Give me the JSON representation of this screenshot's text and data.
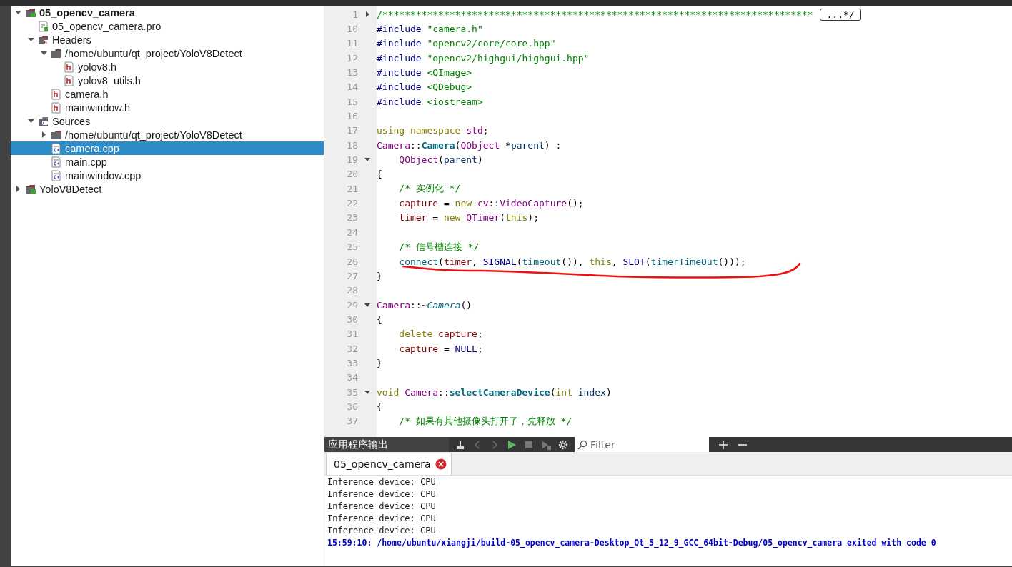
{
  "project_tree": {
    "items": [
      {
        "label": "05_opencv_camera",
        "kind": "project",
        "active": true,
        "expanded": true,
        "selected": false,
        "children": [
          {
            "label": "05_opencv_camera.pro",
            "kind": "pro-file",
            "selected": false
          },
          {
            "label": "Headers",
            "kind": "header-folder",
            "expanded": true,
            "selected": false,
            "children": [
              {
                "label": "/home/ubuntu/qt_project/YoloV8Detect",
                "kind": "folder",
                "expanded": true,
                "selected": false,
                "children": [
                  {
                    "label": "yolov8.h",
                    "kind": "header-file",
                    "selected": false
                  },
                  {
                    "label": "yolov8_utils.h",
                    "kind": "header-file",
                    "selected": false
                  }
                ]
              },
              {
                "label": "camera.h",
                "kind": "header-file",
                "selected": false
              },
              {
                "label": "mainwindow.h",
                "kind": "header-file",
                "selected": false
              }
            ]
          },
          {
            "label": "Sources",
            "kind": "source-folder",
            "expanded": true,
            "selected": false,
            "children": [
              {
                "label": "/home/ubuntu/qt_project/YoloV8Detect",
                "kind": "folder",
                "expanded": false,
                "selected": false
              },
              {
                "label": "camera.cpp",
                "kind": "source-file",
                "selected": true
              },
              {
                "label": "main.cpp",
                "kind": "source-file",
                "selected": false
              },
              {
                "label": "mainwindow.cpp",
                "kind": "source-file",
                "selected": false
              }
            ]
          }
        ]
      },
      {
        "label": "YoloV8Detect",
        "kind": "project",
        "active": false,
        "expanded": false,
        "selected": false
      }
    ]
  },
  "editor": {
    "lines": [
      {
        "number": "1",
        "expanded": false,
        "folded_text": "...*/",
        "tokens": [
          {
            "kind": "comment",
            "text": "/*****************************************************************************"
          }
        ]
      },
      {
        "number": "10",
        "tokens": [
          {
            "kind": "preproc",
            "text": "#include "
          },
          {
            "kind": "string",
            "text": "\"camera.h\""
          }
        ]
      },
      {
        "number": "11",
        "tokens": [
          {
            "kind": "preproc",
            "text": "#include "
          },
          {
            "kind": "string",
            "text": "\"opencv2/core/core.hpp\""
          }
        ]
      },
      {
        "number": "12",
        "tokens": [
          {
            "kind": "preproc",
            "text": "#include "
          },
          {
            "kind": "string",
            "text": "\"opencv2/highgui/highgui.hpp\""
          }
        ]
      },
      {
        "number": "13",
        "tokens": [
          {
            "kind": "preproc",
            "text": "#include "
          },
          {
            "kind": "string",
            "text": "<QImage>"
          }
        ]
      },
      {
        "number": "14",
        "tokens": [
          {
            "kind": "preproc",
            "text": "#include "
          },
          {
            "kind": "string",
            "text": "<QDebug>"
          }
        ]
      },
      {
        "number": "15",
        "tokens": [
          {
            "kind": "preproc",
            "text": "#include "
          },
          {
            "kind": "string",
            "text": "<iostream>"
          }
        ]
      },
      {
        "number": "16"
      },
      {
        "number": "17",
        "tokens": [
          {
            "kind": "keyword",
            "text": "using namespace "
          },
          {
            "kind": "type",
            "text": "std"
          },
          {
            "kind": "plain",
            "text": ";"
          }
        ]
      },
      {
        "number": "18",
        "tokens": [
          {
            "kind": "type",
            "text": "Camera"
          },
          {
            "kind": "plain",
            "text": "::"
          },
          {
            "kind": "function-decl",
            "text": "Camera"
          },
          {
            "kind": "plain",
            "text": "("
          },
          {
            "kind": "type",
            "text": "QObject"
          },
          {
            "kind": "plain",
            "text": " *"
          },
          {
            "kind": "param",
            "text": "parent"
          },
          {
            "kind": "plain",
            "text": ") :"
          }
        ]
      },
      {
        "number": "19",
        "expanded": true,
        "tokens": [
          {
            "kind": "type",
            "text": "    QObject"
          },
          {
            "kind": "plain",
            "text": "("
          },
          {
            "kind": "param",
            "text": "parent"
          },
          {
            "kind": "plain",
            "text": ")"
          }
        ]
      },
      {
        "number": "20",
        "tokens": [
          {
            "kind": "plain",
            "text": "{"
          }
        ]
      },
      {
        "number": "21",
        "tokens": [
          {
            "kind": "comment",
            "text": "    /* 实例化 */"
          }
        ]
      },
      {
        "number": "22",
        "tokens": [
          {
            "kind": "member",
            "text": "    capture"
          },
          {
            "kind": "plain",
            "text": " = "
          },
          {
            "kind": "keyword",
            "text": "new "
          },
          {
            "kind": "type",
            "text": "cv"
          },
          {
            "kind": "plain",
            "text": "::"
          },
          {
            "kind": "type",
            "text": "VideoCapture"
          },
          {
            "kind": "plain",
            "text": "();"
          }
        ]
      },
      {
        "number": "23",
        "tokens": [
          {
            "kind": "member",
            "text": "    timer"
          },
          {
            "kind": "plain",
            "text": " = "
          },
          {
            "kind": "keyword",
            "text": "new "
          },
          {
            "kind": "type",
            "text": "QTimer"
          },
          {
            "kind": "plain",
            "text": "("
          },
          {
            "kind": "keyword",
            "text": "this"
          },
          {
            "kind": "plain",
            "text": ");"
          }
        ]
      },
      {
        "number": "24"
      },
      {
        "number": "25",
        "tokens": [
          {
            "kind": "comment",
            "text": "    /* 信号槽连接 */"
          }
        ]
      },
      {
        "number": "26",
        "annotated": true,
        "tokens": [
          {
            "kind": "function",
            "text": "    connect"
          },
          {
            "kind": "plain",
            "text": "("
          },
          {
            "kind": "member",
            "text": "timer"
          },
          {
            "kind": "plain",
            "text": ", "
          },
          {
            "kind": "macro",
            "text": "SIGNAL"
          },
          {
            "kind": "plain",
            "text": "("
          },
          {
            "kind": "function",
            "text": "timeout"
          },
          {
            "kind": "plain",
            "text": "()), "
          },
          {
            "kind": "keyword",
            "text": "this"
          },
          {
            "kind": "plain",
            "text": ", "
          },
          {
            "kind": "macro",
            "text": "SLOT"
          },
          {
            "kind": "plain",
            "text": "("
          },
          {
            "kind": "function",
            "text": "timerTimeOut"
          },
          {
            "kind": "plain",
            "text": "()));"
          }
        ]
      },
      {
        "number": "27",
        "tokens": [
          {
            "kind": "plain",
            "text": "}"
          }
        ]
      },
      {
        "number": "28"
      },
      {
        "number": "29",
        "expanded": true,
        "tokens": [
          {
            "kind": "type",
            "text": "Camera"
          },
          {
            "kind": "plain",
            "text": "::~"
          },
          {
            "kind": "virtual",
            "text": "Camera"
          },
          {
            "kind": "plain",
            "text": "()"
          }
        ]
      },
      {
        "number": "30",
        "tokens": [
          {
            "kind": "plain",
            "text": "{"
          }
        ]
      },
      {
        "number": "31",
        "tokens": [
          {
            "kind": "keyword",
            "text": "    delete "
          },
          {
            "kind": "member",
            "text": "capture"
          },
          {
            "kind": "plain",
            "text": ";"
          }
        ]
      },
      {
        "number": "32",
        "tokens": [
          {
            "kind": "member",
            "text": "    capture"
          },
          {
            "kind": "plain",
            "text": " = "
          },
          {
            "kind": "macro",
            "text": "NULL"
          },
          {
            "kind": "plain",
            "text": ";"
          }
        ]
      },
      {
        "number": "33",
        "tokens": [
          {
            "kind": "plain",
            "text": "}"
          }
        ]
      },
      {
        "number": "34"
      },
      {
        "number": "35",
        "expanded": true,
        "tokens": [
          {
            "kind": "keyword",
            "text": "void "
          },
          {
            "kind": "type",
            "text": "Camera"
          },
          {
            "kind": "plain",
            "text": "::"
          },
          {
            "kind": "function-decl",
            "text": "selectCameraDevice"
          },
          {
            "kind": "plain",
            "text": "("
          },
          {
            "kind": "keyword",
            "text": "int "
          },
          {
            "kind": "param",
            "text": "index"
          },
          {
            "kind": "plain",
            "text": ")"
          }
        ]
      },
      {
        "number": "36",
        "tokens": [
          {
            "kind": "plain",
            "text": "{"
          }
        ]
      },
      {
        "number": "37",
        "tokens": [
          {
            "kind": "comment",
            "text": "    /* 如果有其他摄像头打开了，先释放 */"
          }
        ]
      }
    ]
  },
  "output_pane": {
    "title": "应用程序输出",
    "filter": {
      "placeholder": "Filter"
    },
    "tabs": [
      {
        "label": "05_opencv_camera",
        "selected": true
      }
    ],
    "lines": [
      {
        "kind": "normal",
        "text": "Inference device: CPU"
      },
      {
        "kind": "normal",
        "text": "Inference device: CPU"
      },
      {
        "kind": "normal",
        "text": "Inference device: CPU"
      },
      {
        "kind": "normal",
        "text": "Inference device: CPU"
      },
      {
        "kind": "normal",
        "text": "Inference device: CPU"
      },
      {
        "kind": "exit",
        "text": "15:59:10: /home/ubuntu/xiangji/build-05_opencv_camera-Desktop_Qt_5_12_9_GCC_64bit-Debug/05_opencv_camera exited with code 0"
      }
    ]
  }
}
